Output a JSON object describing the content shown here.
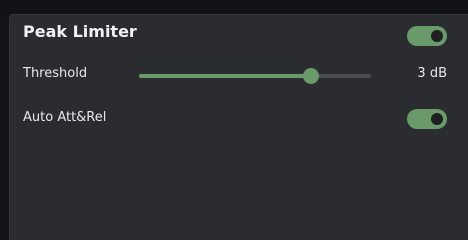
{
  "panel": {
    "title": "Peak Limiter",
    "enabled": true
  },
  "threshold": {
    "label": "Threshold",
    "value_text": "3 dB",
    "level": 0.74
  },
  "auto_att_rel": {
    "label": "Auto Att&Rel",
    "enabled": true
  },
  "colors": {
    "accent": "#6a9a69",
    "panel_bg": "#2a2c30",
    "track": "#4a4d52",
    "text": "#e8e9eb"
  }
}
